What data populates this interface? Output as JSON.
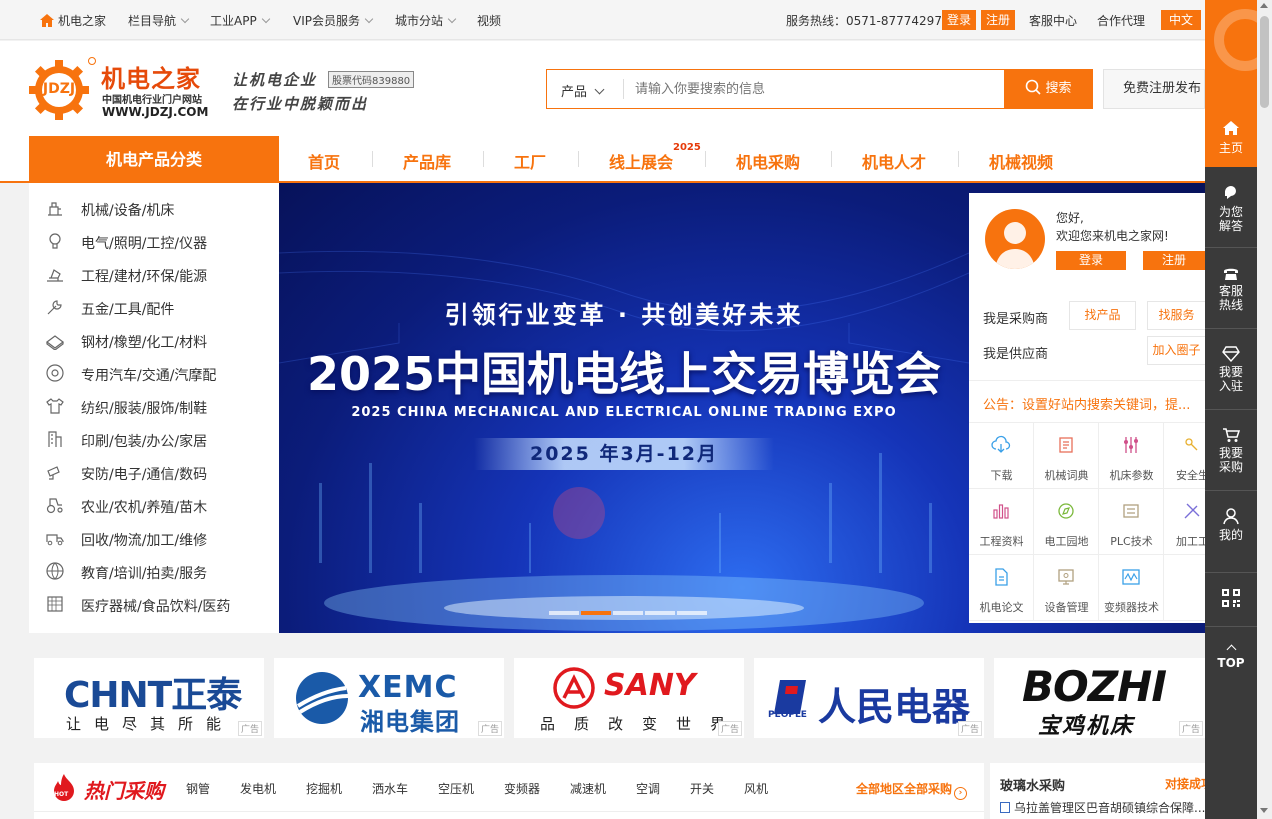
{
  "topbar": {
    "home": "机电之家",
    "nav": "栏目导航",
    "app": "工业APP",
    "vip": "VIP会员服务",
    "city": "城市分站",
    "video": "视频",
    "hotline": "服务热线：0571-87774297",
    "login": "登录",
    "register": "注册",
    "service": "客服中心",
    "agent": "合作代理",
    "lang": "中文"
  },
  "header": {
    "logo_badge": "JDZJ",
    "logo_title": "机电之家",
    "logo_sub": "中国机电行业门户网站",
    "logo_url": "WWW.JDZJ.COM",
    "slogan1": "让机电企业",
    "slogan2": "在行业中脱颖而出",
    "stock_code": "股票代码839880",
    "search_category": "产品",
    "search_placeholder": "请输入你要搜索的信息",
    "search_button": "搜索",
    "free_register": "免费注册发布"
  },
  "nav": {
    "category_title": "机电产品分类",
    "items": [
      "首页",
      "产品库",
      "工厂",
      "线上展会",
      "机电采购",
      "机电人才",
      "机械视频"
    ],
    "expo_badge": "2025"
  },
  "categories": [
    "机械/设备/机床",
    "电气/照明/工控/仪器",
    "工程/建材/环保/能源",
    "五金/工具/配件",
    "钢材/橡塑/化工/材料",
    "专用汽车/交通/汽摩配",
    "纺织/服装/服饰/制鞋",
    "印刷/包装/办公/家居",
    "安防/电子/通信/数码",
    "农业/农机/养殖/苗木",
    "回收/物流/加工/维修",
    "教育/培训/拍卖/服务",
    "医疗器械/食品饮料/医药"
  ],
  "banner": {
    "slogan": "引领行业变革 · 共创美好未来",
    "title": "2025中国机电线上交易博览会",
    "subtitle": "2025 CHINA MECHANICAL AND ELECTRICAL ONLINE TRADING EXPO",
    "dates": "2025 年3月-12月"
  },
  "userpanel": {
    "greeting": "您好,",
    "welcome": "欢迎您来机电之家网!",
    "login": "登录",
    "register": "注册",
    "buyer": "我是采购商",
    "find_product": "找产品",
    "find_service": "找服务",
    "supplier": "我是供应商",
    "join_circle": "加入圈子",
    "notice": "公告：设置好站内搜索关键词，提...",
    "tools": [
      "下载",
      "机械词典",
      "机床参数",
      "安全生",
      "工程资料",
      "电工园地",
      "PLC技术",
      "加工工",
      "机电论文",
      "设备管理",
      "变频器技术"
    ]
  },
  "brands": [
    {
      "name": "CHNT正泰",
      "slogan": "让电尽其所能",
      "ad": "广告"
    },
    {
      "name": "XEMC",
      "cn": "湘电集团",
      "ad": "广告"
    },
    {
      "name": "SANY",
      "slogan": "品质改变世界",
      "ad": "广告"
    },
    {
      "name": "人民电器",
      "en": "PEOPLE",
      "ad": "广告"
    },
    {
      "name": "BOZHI",
      "cn": "宝鸡机床",
      "ad": "广告"
    }
  ],
  "hot": {
    "title": "热门采购",
    "badge": "HOT",
    "tags": [
      "钢管",
      "发电机",
      "挖掘机",
      "洒水车",
      "空压机",
      "变频器",
      "减速机",
      "空调",
      "开关",
      "风机"
    ],
    "all_link": "全部地区全部采购"
  },
  "rightbox": {
    "title": "玻璃水采购",
    "link": "对接成功",
    "item": "乌拉盖管理区巴音胡硕镇综合保障..."
  },
  "sidebar": {
    "items": [
      "主页",
      "为您解答",
      "客服热线",
      "我要入驻",
      "我要采购",
      "我的"
    ],
    "top": "TOP"
  },
  "colors": {
    "accent": "#f7730e",
    "sidebar": "#3a3a3a",
    "banner": "#0b1c7a"
  }
}
